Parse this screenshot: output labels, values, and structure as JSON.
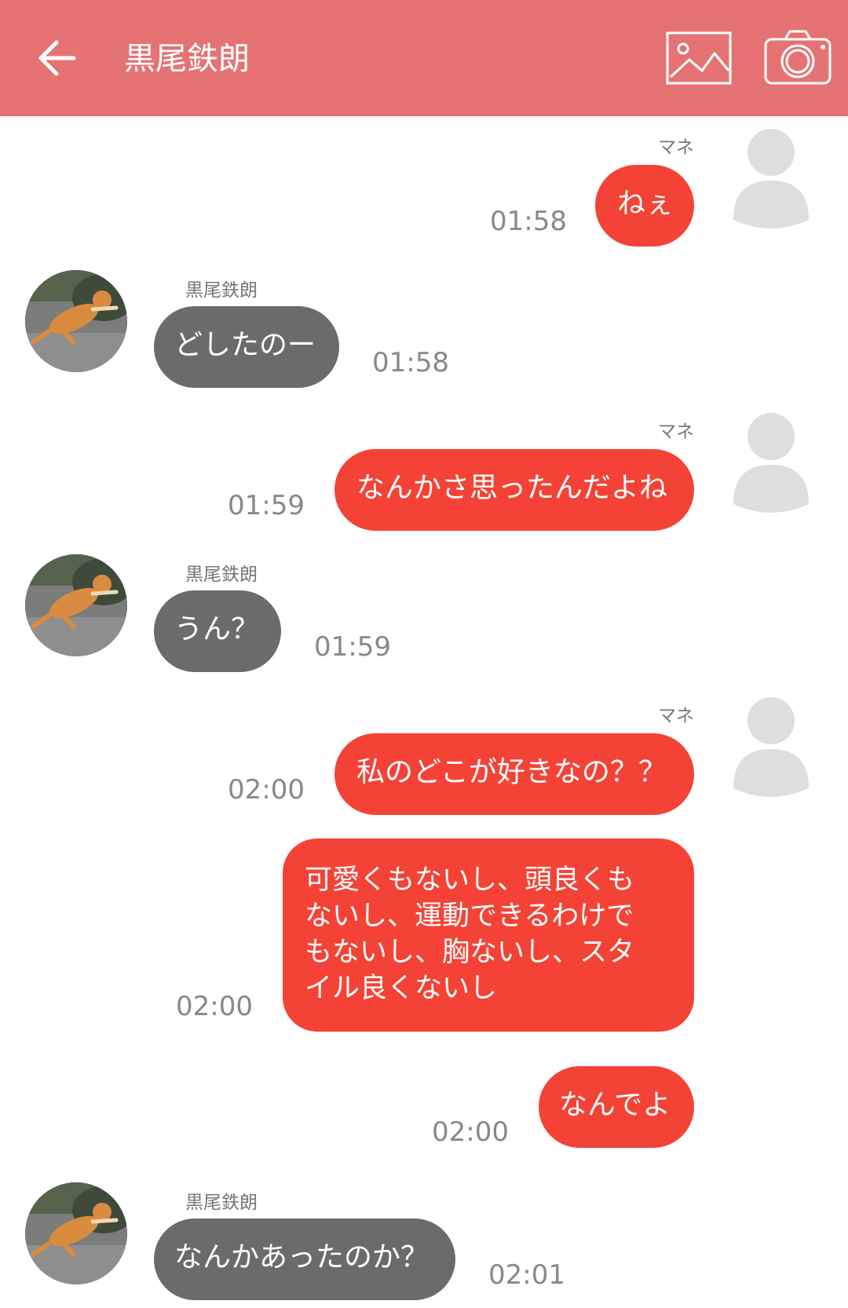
{
  "header": {
    "title": "黒尾鉄朗",
    "back_icon": "arrow-left-icon",
    "gallery_icon": "image-icon",
    "camera_icon": "camera-icon",
    "background": "#e57373"
  },
  "colors": {
    "my_bubble": "#f44336",
    "their_bubble": "#6b6b6b",
    "timestamp": "#888888"
  },
  "messages": [
    {
      "sender": "マネ",
      "text": "ねぇ",
      "time": "01:58"
    },
    {
      "sender": "黒尾鉄朗",
      "text": "どしたのー",
      "time": "01:58"
    },
    {
      "sender": "マネ",
      "text": "なんかさ思ったんだよね",
      "time": "01:59"
    },
    {
      "sender": "黒尾鉄朗",
      "text": "うん？",
      "time": "01:59"
    },
    {
      "sender": "マネ",
      "text": "私のどこが好きなの？？",
      "time": "02:00"
    },
    {
      "text": "可愛くもないし、頭良くもないし、運動できるわけでもないし、胸ないし、スタイル良くないし",
      "time": "02:00"
    },
    {
      "text": "なんでよ",
      "time": "02:00"
    },
    {
      "sender": "黒尾鉄朗",
      "text": "なんかあったのか？",
      "time": "02:01"
    }
  ]
}
